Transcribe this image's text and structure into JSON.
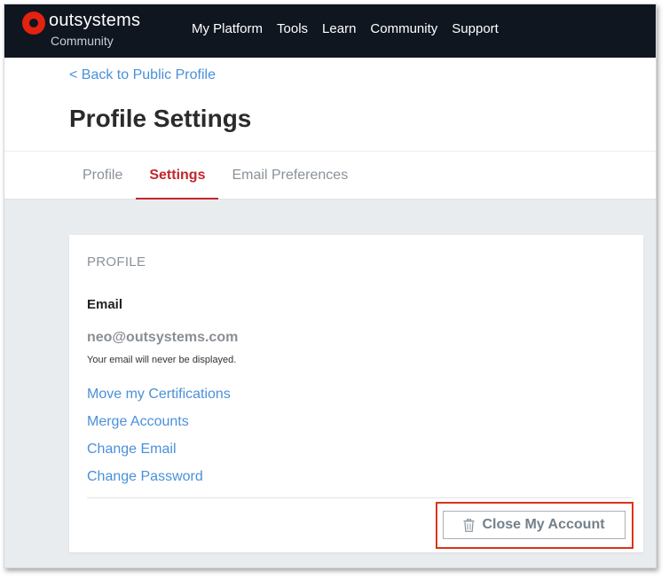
{
  "brand": {
    "name": "outsystems",
    "sub": "Community",
    "accent": "#e3220f"
  },
  "nav": {
    "items": [
      "My Platform",
      "Tools",
      "Learn",
      "Community",
      "Support"
    ]
  },
  "header": {
    "back_link": "< Back to Public Profile",
    "title": "Profile Settings",
    "tabs": [
      {
        "label": "Profile",
        "active": false
      },
      {
        "label": "Settings",
        "active": true
      },
      {
        "label": "Email Preferences",
        "active": false
      }
    ]
  },
  "card": {
    "heading": "PROFILE",
    "email_label": "Email",
    "email_value": "neo@outsystems.com",
    "email_note": "Your email will never be displayed.",
    "links": [
      "Move my Certifications",
      "Merge Accounts",
      "Change Email",
      "Change Password"
    ],
    "close_button": "Close My Account",
    "close_icon": "trash-icon"
  }
}
